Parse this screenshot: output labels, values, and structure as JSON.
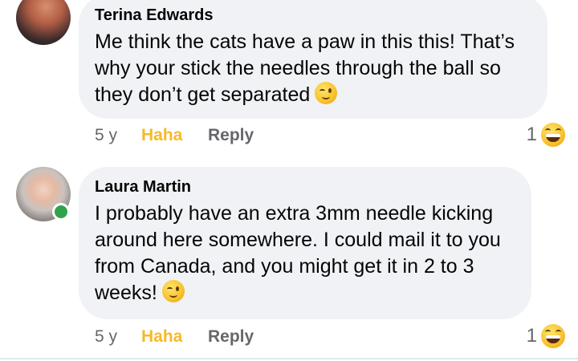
{
  "comments": [
    {
      "author": "Terina Edwards",
      "text": "Me think the cats have a paw in this this! That’s why your stick the needles through the ball so they don’t get separated",
      "emoji": "winking-face",
      "age": "5 y",
      "react_label": "Haha",
      "reply_label": "Reply",
      "reaction_count": "1",
      "reaction_emoji": "laughing-face",
      "online": false
    },
    {
      "author": "Laura Martin",
      "text": "I probably have an extra 3mm needle kicking around here somewhere. I could mail it to you from Canada, and you might get it in 2 to 3 weeks!",
      "emoji": "winking-face",
      "age": "5 y",
      "react_label": "Haha",
      "reply_label": "Reply",
      "reaction_count": "1",
      "reaction_emoji": "laughing-face",
      "online": true
    }
  ],
  "colors": {
    "bubble_bg": "#f0f2f5",
    "react_active": "#f7b928",
    "secondary_text": "#65676b",
    "online": "#31a24c"
  }
}
